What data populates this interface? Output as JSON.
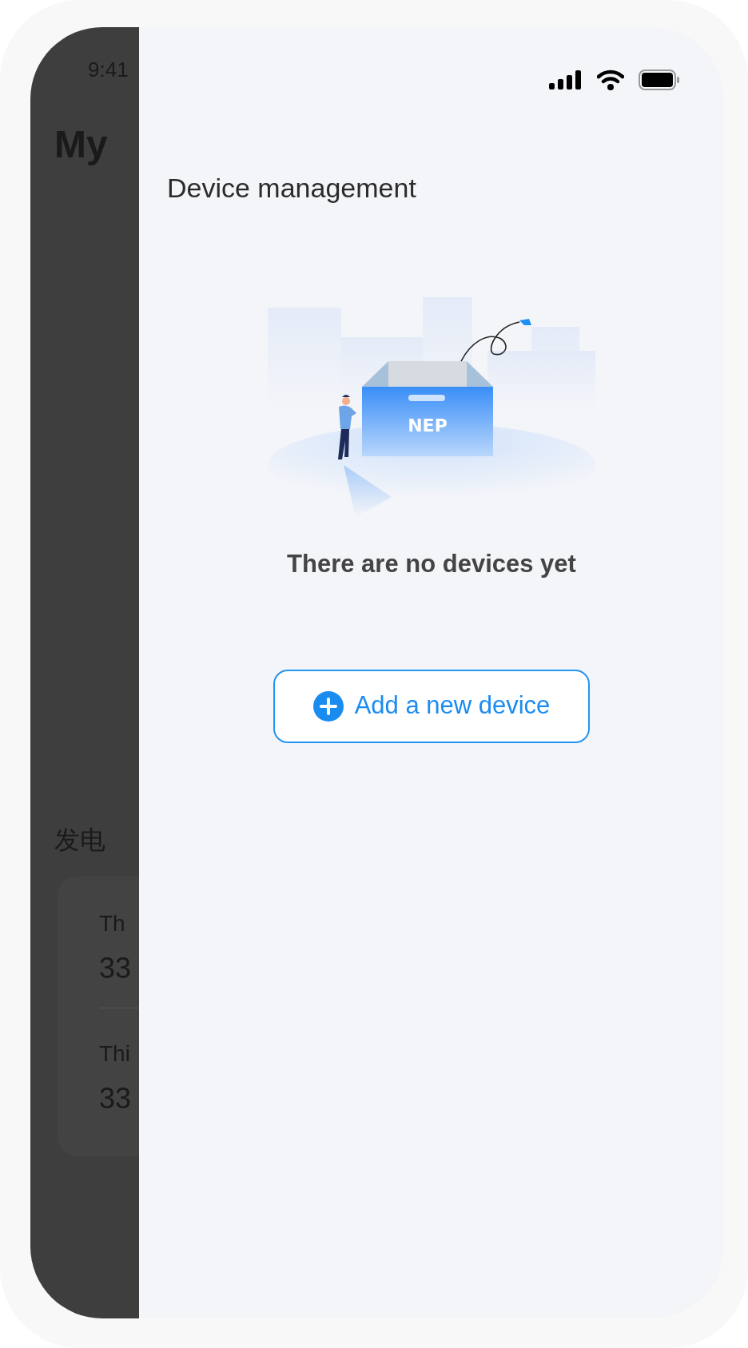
{
  "background_app": {
    "status_time": "9:41",
    "title": "My",
    "section_title": "发电",
    "stats": [
      {
        "label": "Th",
        "value": "33"
      },
      {
        "label": "Thi",
        "value": "33"
      }
    ]
  },
  "drawer": {
    "title": "Device management",
    "box_label": "NEP",
    "empty_message": "There are no devices yet",
    "add_button": {
      "label": "Add a new device"
    }
  }
}
